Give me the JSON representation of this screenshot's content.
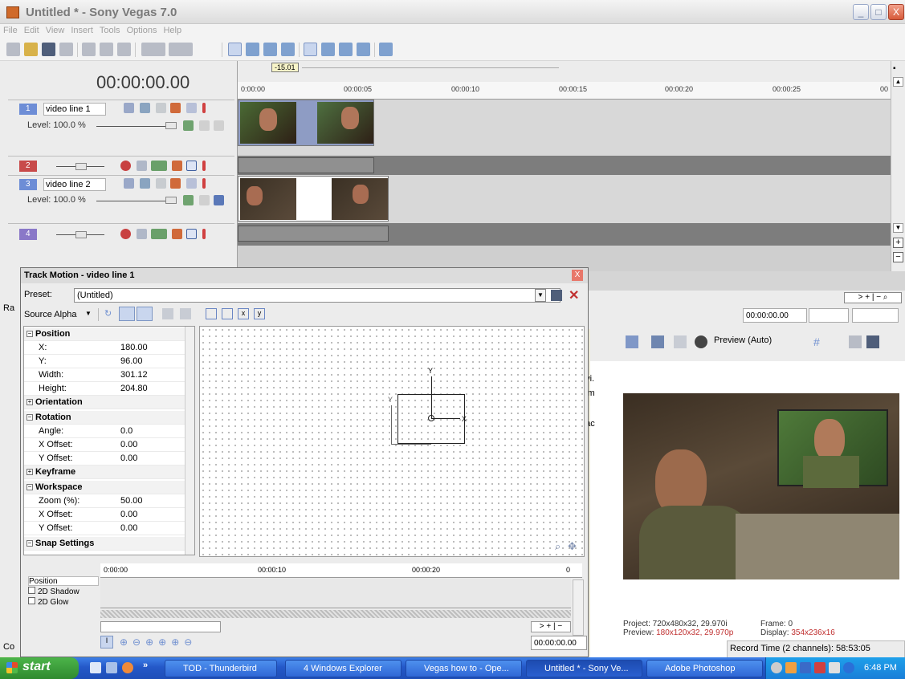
{
  "window": {
    "title": "Untitled * - Sony Vegas 7.0",
    "controls": [
      "_",
      "□",
      "X"
    ]
  },
  "menu": [
    "File",
    "Edit",
    "View",
    "Insert",
    "Tools",
    "Options",
    "Help"
  ],
  "timeline": {
    "timecode": "00:00:00.00",
    "marker": "-15.01",
    "ruler": [
      "0:00:00",
      "00:00:05",
      "00:00:10",
      "00:00:15",
      "00:00:20",
      "00:00:25",
      "00"
    ],
    "tracks": [
      {
        "num": "1",
        "name": "video line 1",
        "level": "Level: 100.0 %"
      },
      {
        "num": "2",
        "name": "",
        "level": ""
      },
      {
        "num": "3",
        "name": "video line 2",
        "level": "Level: 100.0 %"
      },
      {
        "num": "4",
        "name": "",
        "level": ""
      }
    ]
  },
  "dialog": {
    "title": "Track Motion - video line 1",
    "close": "X",
    "preset_label": "Preset:",
    "preset_value": "(Untitled)",
    "source_alpha": "Source Alpha",
    "properties": [
      {
        "type": "group",
        "name": "Position",
        "sign": "−"
      },
      {
        "type": "prop",
        "name": "X:",
        "value": "180.00"
      },
      {
        "type": "prop",
        "name": "Y:",
        "value": "96.00"
      },
      {
        "type": "prop",
        "name": "Width:",
        "value": "301.12"
      },
      {
        "type": "prop",
        "name": "Height:",
        "value": "204.80"
      },
      {
        "type": "group",
        "name": "Orientation",
        "sign": "+"
      },
      {
        "type": "group",
        "name": "Rotation",
        "sign": "−"
      },
      {
        "type": "prop",
        "name": "Angle:",
        "value": "0.0"
      },
      {
        "type": "prop",
        "name": "X Offset:",
        "value": "0.00"
      },
      {
        "type": "prop",
        "name": "Y Offset:",
        "value": "0.00"
      },
      {
        "type": "group",
        "name": "Keyframe",
        "sign": "+"
      },
      {
        "type": "group",
        "name": "Workspace",
        "sign": "−"
      },
      {
        "type": "prop",
        "name": "Zoom (%):",
        "value": "50.00"
      },
      {
        "type": "prop",
        "name": "X Offset:",
        "value": "0.00"
      },
      {
        "type": "prop",
        "name": "Y Offset:",
        "value": "0.00"
      },
      {
        "type": "group",
        "name": "Snap Settings",
        "sign": "−"
      }
    ],
    "canvas_axes": {
      "x": "X",
      "y": "Y"
    },
    "kf_ruler": [
      "0:00:00",
      "00:00:10",
      "00:00:20",
      "0"
    ],
    "kf_tracks": [
      "Position",
      "2D Shadow",
      "2D Glow"
    ],
    "kf_timecode": "00:00:00.00"
  },
  "right_panel": {
    "timecode": "00:00:00.00",
    "preview_mode": "Preview (Auto)",
    "partial_text": [
      "avi.",
      "stm",
      "bac",
      "e"
    ],
    "project": "Project:  720x480x32, 29.970i",
    "preview_label": "Preview: ",
    "preview_value": "180x120x32, 29.970p",
    "frame": "Frame:   0",
    "display_label": "Display: ",
    "display_value": "354x236x16",
    "record_time": "Record Time (2 channels): 58:53:05"
  },
  "left_stub": {
    "ra": "Ra",
    "co": "Co"
  },
  "taskbar": {
    "start": "start",
    "chevron": "»",
    "items": [
      {
        "label": "TOD - Thunderbird"
      },
      {
        "label": "4 Windows Explorer"
      },
      {
        "label": "Vegas how to - Ope..."
      },
      {
        "label": "Untitled * - Sony Ve..."
      },
      {
        "label": "Adobe Photoshop"
      }
    ],
    "clock": "6:48 PM"
  }
}
